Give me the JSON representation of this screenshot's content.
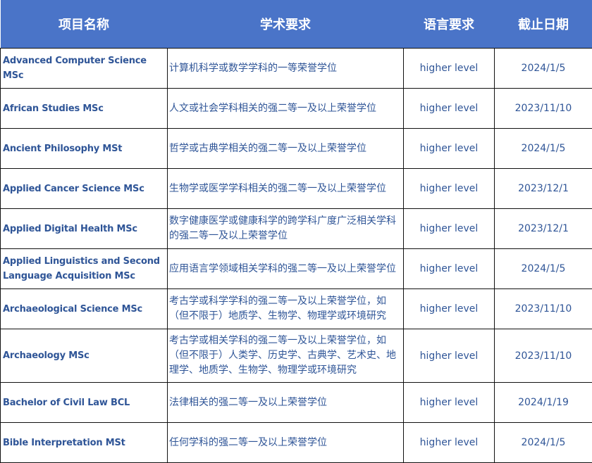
{
  "table": {
    "headers": [
      "项目名称",
      "学术要求",
      "语言要求",
      "截止日期"
    ],
    "header_bg": "#4a74c8",
    "text_color": "#2f5597",
    "rows": [
      {
        "name": "Advanced Computer Science MSc",
        "academic": "计算机科学或数学学科的一等荣誉学位",
        "language": "higher level",
        "deadline": "2024/1/5"
      },
      {
        "name": "African Studies MSc",
        "academic": "人文或社会学科相关的强二等一及以上荣誉学位",
        "language": "higher level",
        "deadline": "2023/11/10"
      },
      {
        "name": "Ancient Philosophy MSt",
        "academic": "哲学或古典学相关的强二等一及以上荣誉学位",
        "language": "higher level",
        "deadline": "2024/1/5"
      },
      {
        "name": "Applied Cancer Science MSc",
        "academic": "生物学或医学学科相关的强二等一及以上荣誉学位",
        "language": "higher level",
        "deadline": "2023/12/1"
      },
      {
        "name": "Applied Digital Health MSc",
        "academic": "数字健康医学或健康科学的跨学科广度广泛相关学科的强二等一及以上荣誉学位",
        "language": "higher level",
        "deadline": "2023/12/1"
      },
      {
        "name": "Applied Linguistics and Second Language Acquisition MSc",
        "academic": "应用语言学领域相关学科的强二等一及以上荣誉学位",
        "language": "higher level",
        "deadline": "2024/1/5"
      },
      {
        "name": "Archaeological Science MSc",
        "academic": "考古学或科学学科的强二等一及以上荣誉学位，如（但不限于）地质学、生物学、物理学或环境研究",
        "language": "higher level",
        "deadline": "2023/11/10"
      },
      {
        "name": "Archaeology MSc",
        "academic": "考古学或相关学科的强二等一及以上荣誉学位，如（但不限于）人类学、历史学、古典学、艺术史、地理学、地质学、生物学、物理学或环境研究",
        "language": "higher level",
        "deadline": "2023/11/10"
      },
      {
        "name": "Bachelor of Civil Law BCL",
        "academic": "法律相关的强二等一及以上荣誉学位",
        "language": "higher level",
        "deadline": "2024/1/19"
      },
      {
        "name": "Bible Interpretation MSt",
        "academic": "任何学科的强二等一及以上荣誉学位",
        "language": "higher level",
        "deadline": "2024/1/5"
      }
    ]
  }
}
